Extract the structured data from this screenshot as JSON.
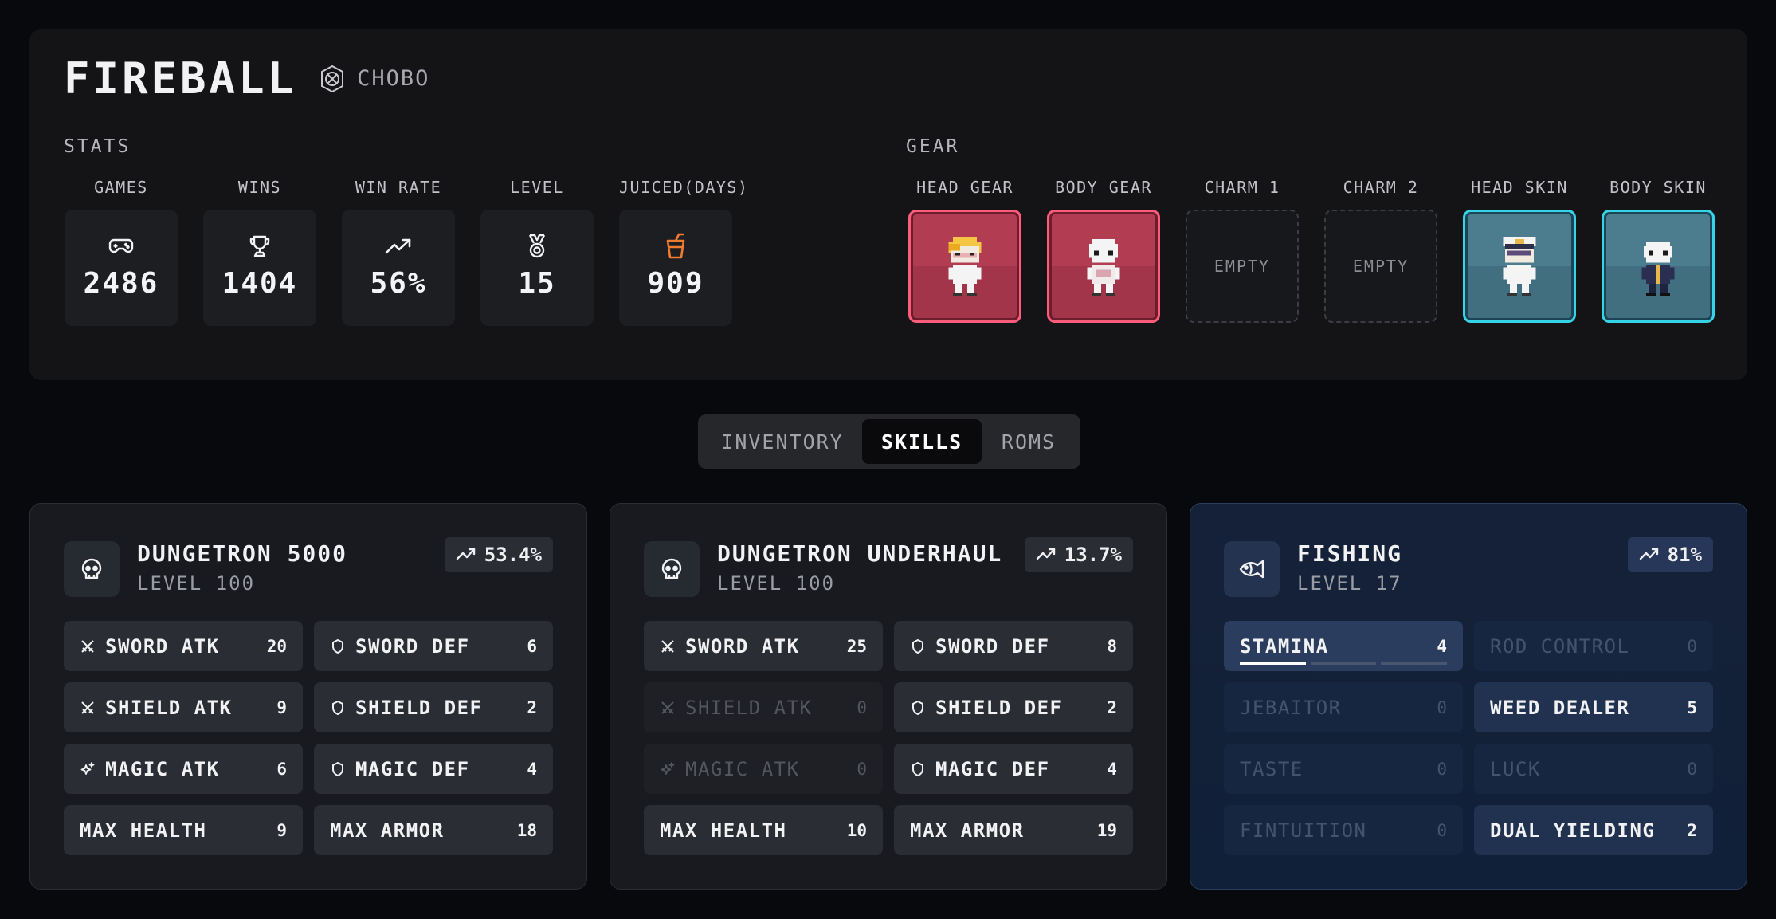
{
  "player": {
    "name": "FIREBALL",
    "guild": "CHOBO",
    "guild_icon": "guild-emblem-icon"
  },
  "stats": {
    "title": "STATS",
    "items": [
      {
        "label": "GAMES",
        "value": "2486",
        "icon": "gamepad-icon"
      },
      {
        "label": "WINS",
        "value": "1404",
        "icon": "trophy-icon"
      },
      {
        "label": "WIN RATE",
        "value": "56%",
        "icon": "trend-up-icon"
      },
      {
        "label": "LEVEL",
        "value": "15",
        "icon": "medal-icon"
      },
      {
        "label": "JUICED(DAYS)",
        "value": "909",
        "icon": "juice-cup-icon",
        "icon_color": "#f07a2e"
      }
    ]
  },
  "gear": {
    "title": "GEAR",
    "slots": [
      {
        "label": "HEAD GEAR",
        "state": "equipped",
        "rarity_color": "#ff5c7c"
      },
      {
        "label": "BODY GEAR",
        "state": "equipped",
        "rarity_color": "#ff5c7c"
      },
      {
        "label": "CHARM 1",
        "state": "empty",
        "empty_text": "EMPTY"
      },
      {
        "label": "CHARM 2",
        "state": "empty",
        "empty_text": "EMPTY"
      },
      {
        "label": "HEAD SKIN",
        "state": "equipped",
        "rarity_color": "#35d4e6"
      },
      {
        "label": "BODY SKIN",
        "state": "equipped",
        "rarity_color": "#35d4e6"
      }
    ]
  },
  "tabs": [
    {
      "label": "INVENTORY",
      "active": false
    },
    {
      "label": "SKILLS",
      "active": true
    },
    {
      "label": "ROMS",
      "active": false
    }
  ],
  "skill_cards": [
    {
      "title": "DUNGETRON 5000",
      "level": "LEVEL 100",
      "win_rate": "53.4%",
      "icon": "skull-icon",
      "skills": [
        {
          "name": "SWORD ATK",
          "value": "20",
          "icon": "crossed-swords-icon"
        },
        {
          "name": "SWORD DEF",
          "value": "6",
          "icon": "shield-icon"
        },
        {
          "name": "SHIELD ATK",
          "value": "9",
          "icon": "crossed-swords-icon"
        },
        {
          "name": "SHIELD DEF",
          "value": "2",
          "icon": "shield-icon"
        },
        {
          "name": "MAGIC ATK",
          "value": "6",
          "icon": "sparkle-icon"
        },
        {
          "name": "MAGIC DEF",
          "value": "4",
          "icon": "shield-icon"
        },
        {
          "name": "MAX HEALTH",
          "value": "9"
        },
        {
          "name": "MAX ARMOR",
          "value": "18"
        }
      ]
    },
    {
      "title": "DUNGETRON UNDERHAUL",
      "level": "LEVEL 100",
      "win_rate": "13.7%",
      "icon": "skull-icon",
      "skills": [
        {
          "name": "SWORD ATK",
          "value": "25",
          "icon": "crossed-swords-icon"
        },
        {
          "name": "SWORD DEF",
          "value": "8",
          "icon": "shield-icon"
        },
        {
          "name": "SHIELD ATK",
          "value": "0",
          "icon": "crossed-swords-icon"
        },
        {
          "name": "SHIELD DEF",
          "value": "2",
          "icon": "shield-icon"
        },
        {
          "name": "MAGIC ATK",
          "value": "0",
          "icon": "sparkle-icon"
        },
        {
          "name": "MAGIC DEF",
          "value": "4",
          "icon": "shield-icon"
        },
        {
          "name": "MAX HEALTH",
          "value": "10"
        },
        {
          "name": "MAX ARMOR",
          "value": "19"
        }
      ]
    },
    {
      "title": "FISHING",
      "level": "LEVEL 17",
      "win_rate": "81%",
      "icon": "fish-icon",
      "skills": [
        {
          "name": "STAMINA",
          "value": "4",
          "progress": 0.33
        },
        {
          "name": "ROD CONTROL",
          "value": "0"
        },
        {
          "name": "JEBAITOR",
          "value": "0"
        },
        {
          "name": "WEED DEALER",
          "value": "5"
        },
        {
          "name": "TASTE",
          "value": "0"
        },
        {
          "name": "LUCK",
          "value": "0"
        },
        {
          "name": "FINTUITION",
          "value": "0"
        },
        {
          "name": "DUAL YIELDING",
          "value": "2"
        }
      ]
    }
  ],
  "colors": {
    "accent_red": "#ff5c7c",
    "accent_teal": "#35d4e6",
    "juice_orange": "#f07a2e"
  }
}
